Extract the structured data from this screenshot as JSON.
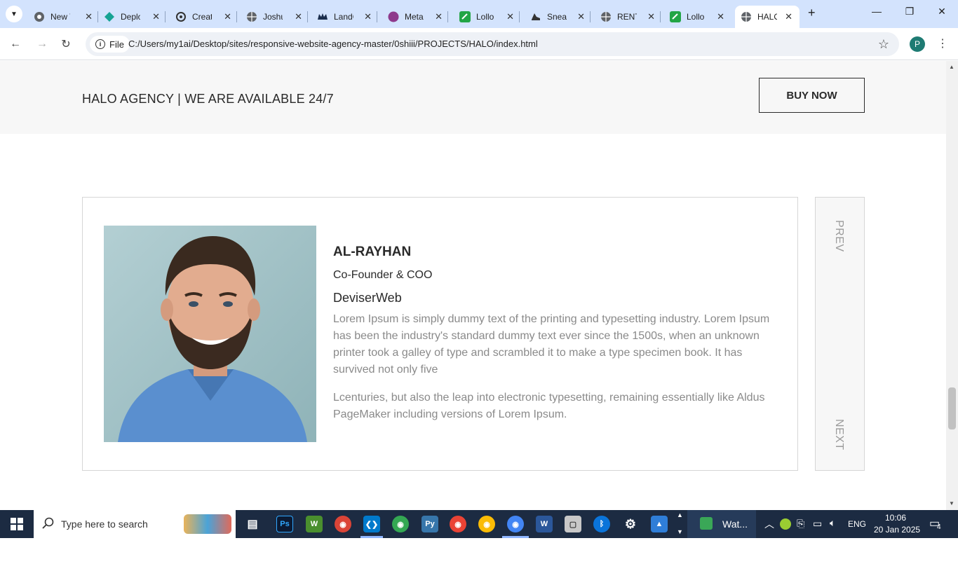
{
  "browser": {
    "tabs": [
      {
        "label": "New T",
        "icon": "chrome-icon"
      },
      {
        "label": "Deplo",
        "icon": "deploy-icon"
      },
      {
        "label": "Creat",
        "icon": "openai-icon"
      },
      {
        "label": "Joshu",
        "icon": "globe-icon"
      },
      {
        "label": "LandC",
        "icon": "crown-icon"
      },
      {
        "label": "Meta",
        "icon": "meta-circle-icon"
      },
      {
        "label": "Lollo",
        "icon": "lollo-icon"
      },
      {
        "label": "Sneak",
        "icon": "sneaker-icon"
      },
      {
        "label": "RENT",
        "icon": "globe-icon"
      },
      {
        "label": "Lollo",
        "icon": "lollo-icon"
      },
      {
        "label": "HALO",
        "icon": "globe-icon",
        "active": true
      }
    ],
    "file_chip": "File",
    "url": "C:/Users/my1ai/Desktop/sites/responsive-website-agency-master/0shiii/PROJECTS/HALO/index.html",
    "profile_initial": "P"
  },
  "page": {
    "banner_title": "HALO AGENCY | WE ARE AVAILABLE 24/7",
    "buy_button": "BUY NOW",
    "testimonial": {
      "name": "AL-RAYHAN",
      "role": "Co-Founder & COO",
      "company": "DeviserWeb",
      "paragraph1": "Lorem Ipsum is simply dummy text of the printing and typesetting industry. Lorem Ipsum has been the industry's standard dummy text ever since the 1500s, when an unknown printer took a galley of type and scrambled it to make a type specimen book. It has survived not only five",
      "paragraph2": "Lcenturies, but also the leap into electronic typesetting, remaining essentially like Aldus PageMaker including versions of Lorem Ipsum."
    },
    "prev_label": "PREV",
    "next_label": "NEXT"
  },
  "taskbar": {
    "search_placeholder": "Type here to search",
    "weather_label": "Wat...",
    "language": "ENG",
    "time": "10:06",
    "date": "20 Jan 2025",
    "notification_count": "4"
  },
  "colors": {
    "tabstrip": "#d3e3fd",
    "banner_bg": "#f7f7f7",
    "text_dark": "#2a2a2a",
    "text_muted": "#8a8a8a",
    "taskbar_bg": "#1c2b42"
  }
}
